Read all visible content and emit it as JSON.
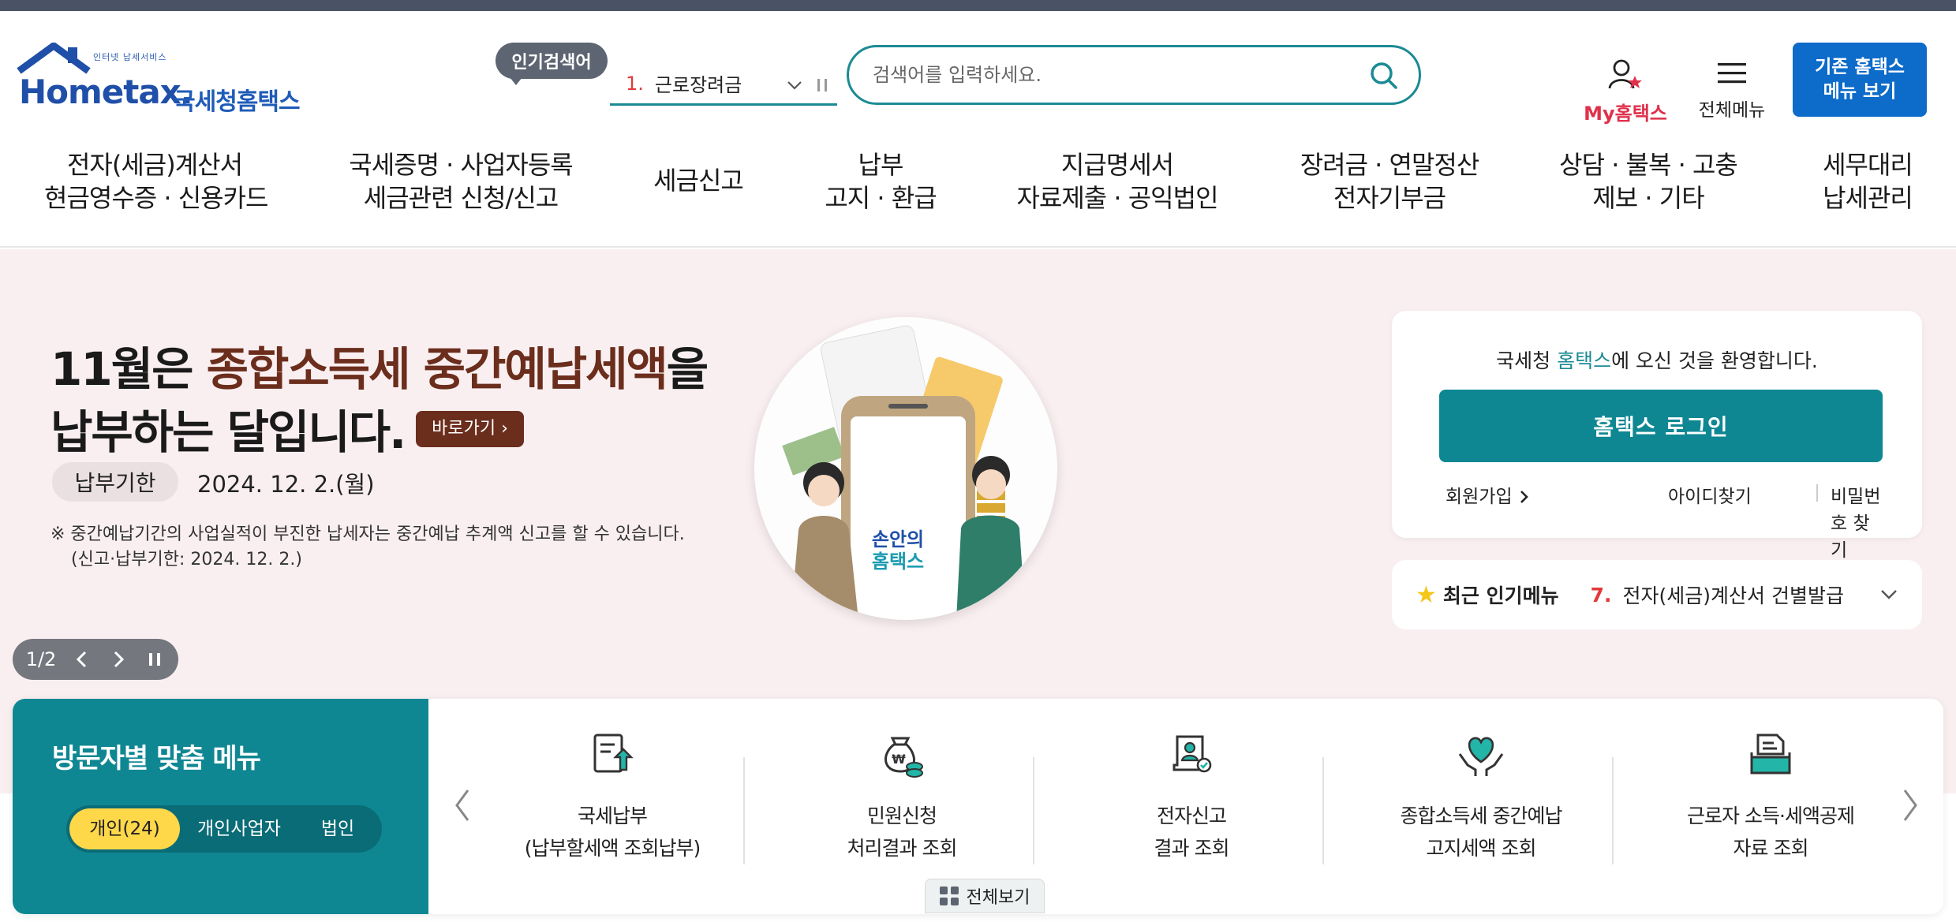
{
  "logo": {
    "small_text": "인터넷 납세서비스",
    "brand": "Hometax.",
    "kr_name": "국세청홈택스"
  },
  "popular": {
    "badge": "인기검색어",
    "rank": "1.",
    "term": "근로장려금"
  },
  "search": {
    "placeholder": "검색어를 입력하세요."
  },
  "utility": {
    "my_hometax": "My홈택스",
    "all_menu": "전체메뉴",
    "legacy_line1": "기존 홈택스",
    "legacy_line2": "메뉴 보기"
  },
  "gnb": [
    {
      "line1": "전자(세금)계산서",
      "line2": "현금영수증 · 신용카드"
    },
    {
      "line1": "국세증명 · 사업자등록",
      "line2": "세금관련 신청/신고"
    },
    {
      "line1": "세금신고",
      "line2": ""
    },
    {
      "line1": "납부",
      "line2": "고지 · 환급"
    },
    {
      "line1": "지급명세서",
      "line2": "자료제출 · 공익법인"
    },
    {
      "line1": "장려금 · 연말정산",
      "line2": "전자기부금"
    },
    {
      "line1": "상담 · 불복 · 고충",
      "line2": "제보 · 기타"
    },
    {
      "line1": "세무대리",
      "line2": "납세관리"
    }
  ],
  "hero": {
    "title_pre": "11월은 ",
    "title_hl": "종합소득세 중간예납세액",
    "title_post": "을",
    "title_line2": "납부하는 달입니다.",
    "go_button": "바로가기",
    "due_label": "납부기한",
    "due_date": "2024. 12. 2.(월)",
    "note_line1": "※ 중간예납기간의 사업실적이 부진한 납세자는 중간예납 추계액 신고를 할 수 있습니다.",
    "note_line2": "(신고·납부기한: 2024. 12. 2.)",
    "illust_text_line1": "손안의",
    "illust_text_line2": "홈택스"
  },
  "slider": {
    "counter": "1/2"
  },
  "login": {
    "welcome_pre": "국세청 ",
    "welcome_hl": "홈택스",
    "welcome_post": "에 오신 것을 환영합니다.",
    "login_button": "홈택스 로그인",
    "signup": "회원가입",
    "find_id": "아이디찾기",
    "find_pw": "비밀번호 찾기"
  },
  "recent": {
    "label": "최근 인기메뉴",
    "rank": "7.",
    "item": "전자(세금)계산서 건별발급"
  },
  "custom_menu": {
    "title": "방문자별 맞춤 메뉴",
    "tabs": [
      "개인(24)",
      "개인사업자",
      "법인"
    ],
    "cards": [
      {
        "line1": "국세납부",
        "line2": "(납부할세액 조회납부)",
        "icon": "tax-payment-icon"
      },
      {
        "line1": "민원신청",
        "line2": "처리결과 조회",
        "icon": "money-bag-icon"
      },
      {
        "line1": "전자신고",
        "line2": "결과 조회",
        "icon": "certificate-icon"
      },
      {
        "line1": "종합소득세 중간예납",
        "line2": "고지세액 조회",
        "icon": "heart-hands-icon"
      },
      {
        "line1": "근로자 소득·세액공제",
        "line2": "자료 조회",
        "icon": "document-tray-icon"
      }
    ],
    "view_all": "전체보기"
  },
  "colors": {
    "teal": "#0f8793",
    "blue": "#0d6bc9",
    "brown": "#6b2d1c",
    "hero_bg": "#f9eff1",
    "red": "#e03a3a",
    "yellow": "#ffd84a"
  }
}
